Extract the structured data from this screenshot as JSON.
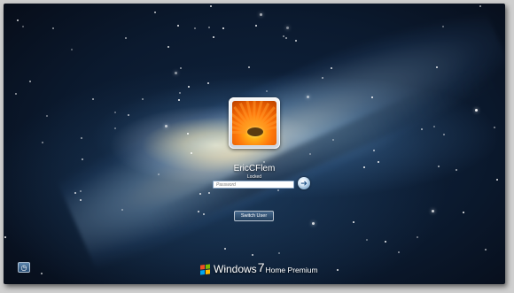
{
  "user": {
    "name": "EricCFlem",
    "status": "Locked"
  },
  "password": {
    "placeholder": "Password",
    "value": ""
  },
  "buttons": {
    "switch_user_label": "Switch User"
  },
  "branding": {
    "name": "Windows",
    "version": "7",
    "edition": "Home Premium"
  },
  "icons": {
    "submit": "arrow-right-icon",
    "ease_of_access": "ease-of-access-icon",
    "windows_logo": "windows-logo-icon",
    "user_picture": "orange-flower-picture"
  },
  "colors": {
    "background": "#0b1a2f",
    "galaxy_core": "#f5e6b4",
    "field_border": "#8aa7c7",
    "text": "#ffffff"
  }
}
